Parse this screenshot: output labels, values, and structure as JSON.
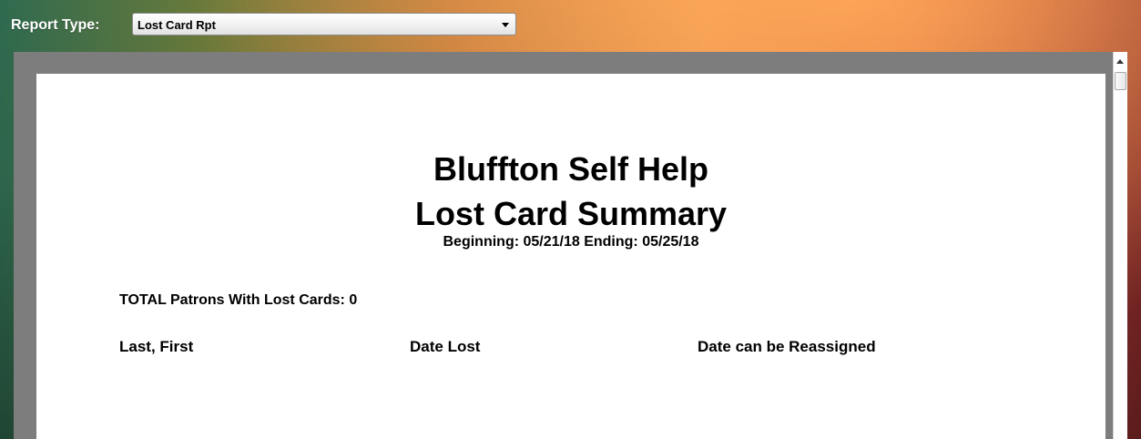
{
  "toolbar": {
    "report_type_label": "Report Type:",
    "report_type_value": "Lost Card Rpt"
  },
  "report": {
    "title": "Bluffton Self Help",
    "subtitle": "Lost Card Summary",
    "date_range": "Beginning: 05/21/18 Ending: 05/25/18",
    "total_line": "TOTAL Patrons With Lost Cards: 0",
    "columns": [
      "Last, First",
      "Date Lost",
      "Date can be Reassigned"
    ]
  },
  "icons": {
    "select_caret": "chevron-down-icon",
    "scroll_up": "arrow-up-icon"
  },
  "colors": {
    "viewer_background": "#7d7d7d",
    "page_background": "#ffffff",
    "label_text": "#ffffff"
  }
}
